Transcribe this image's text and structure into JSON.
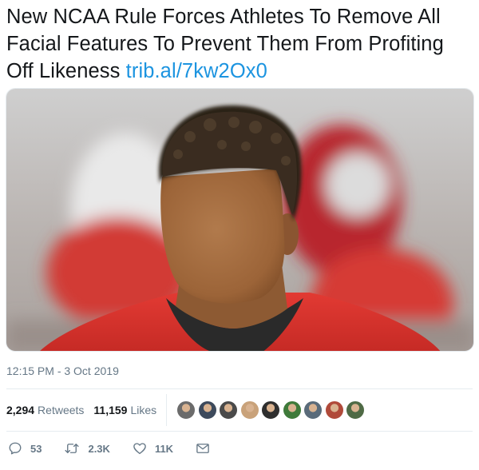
{
  "tweet": {
    "text": "New NCAA Rule Forces Athletes To Remove All Facial Features To Prevent Them From Profiting Off Likeness",
    "link": "trib.al/7kw2Ox0",
    "timestamp": "12:15 PM - 3 Oct 2019"
  },
  "stats": {
    "retweets_count": "2,294",
    "retweets_label": "Retweets",
    "likes_count": "11,159",
    "likes_label": "Likes"
  },
  "liker_avatars": [
    {
      "color": "#6b6b6b"
    },
    {
      "color": "#3d4a5c"
    },
    {
      "color": "#4a4a4a"
    },
    {
      "color": "#c9a27a"
    },
    {
      "color": "#2e2e2e"
    },
    {
      "color": "#3f7a3a"
    },
    {
      "color": "#5a6b7a"
    },
    {
      "color": "#b04a3a"
    },
    {
      "color": "#4f6a45"
    }
  ],
  "actions": {
    "reply_count": "53",
    "retweet_count": "2.3K",
    "like_count": "11K"
  },
  "colors": {
    "link": "#1c94e0",
    "muted": "#657786",
    "jersey_red": "#d8332f"
  }
}
